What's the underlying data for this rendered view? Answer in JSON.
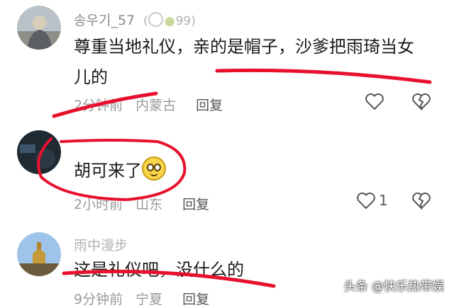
{
  "comments": [
    {
      "username": "송우기_57",
      "badge_count": "99",
      "text_line1": "尊重当地礼仪，亲的是帽子，沙爹把雨琦当女",
      "text_line2": "儿的",
      "time": "2分钟前",
      "location": "内蒙古",
      "reply_label": "回复",
      "like_count": ""
    },
    {
      "username": "",
      "text_line1": "胡可来了",
      "time": "2小时前",
      "location": "山东",
      "reply_label": "回复",
      "like_count": "1"
    },
    {
      "username": "雨中漫步",
      "text_line1": "这是礼仪吧，没什么的",
      "time": "9分钟前",
      "location": "宁夏",
      "reply_label": "回复"
    }
  ],
  "watermark": "头条 @快乐热带娱",
  "colors": {
    "annotation": "#e8112d",
    "meta": "#9a9a9a"
  }
}
